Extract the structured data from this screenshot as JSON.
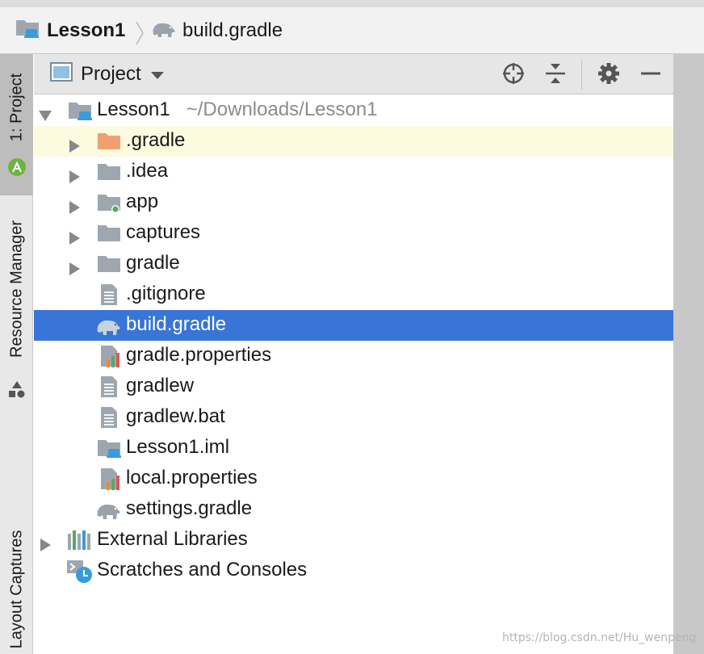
{
  "breadcrumb": {
    "project": "Lesson1",
    "file": "build.gradle"
  },
  "tool_strip": {
    "tabs": [
      {
        "label": "1: Project",
        "icon": "android-icon",
        "active": true
      },
      {
        "label": "Resource Manager",
        "icon": "shapes-icon",
        "active": false
      },
      {
        "label": "Layout Captures",
        "active": false
      }
    ]
  },
  "panel": {
    "view_selector": "Project",
    "actions": [
      "locate-icon",
      "collapse-all-icon",
      "gear-icon",
      "minimize-icon"
    ]
  },
  "tree": {
    "root": {
      "label": "Lesson1",
      "path": "~/Downloads/Lesson1"
    },
    "items": [
      {
        "label": ".gradle",
        "icon": "folder-orange-icon",
        "expandable": true,
        "state": "hover"
      },
      {
        "label": ".idea",
        "icon": "folder-icon",
        "expandable": true
      },
      {
        "label": "app",
        "icon": "module-folder-icon",
        "expandable": true
      },
      {
        "label": "captures",
        "icon": "folder-icon",
        "expandable": true
      },
      {
        "label": "gradle",
        "icon": "folder-icon",
        "expandable": true
      },
      {
        "label": ".gitignore",
        "icon": "text-file-icon",
        "expandable": false
      },
      {
        "label": "build.gradle",
        "icon": "gradle-elephant-icon",
        "expandable": false,
        "state": "selected"
      },
      {
        "label": "gradle.properties",
        "icon": "properties-file-icon",
        "expandable": false
      },
      {
        "label": "gradlew",
        "icon": "text-file-icon",
        "expandable": false
      },
      {
        "label": "gradlew.bat",
        "icon": "text-file-icon",
        "expandable": false
      },
      {
        "label": "Lesson1.iml",
        "icon": "module-file-icon",
        "expandable": false
      },
      {
        "label": "local.properties",
        "icon": "properties-file-icon",
        "expandable": false
      },
      {
        "label": "settings.gradle",
        "icon": "gradle-elephant-icon",
        "expandable": false
      }
    ],
    "external_libraries": "External Libraries",
    "scratches": "Scratches and Consoles"
  },
  "colors": {
    "selection": "#3875d7",
    "hover_row": "#fcfbdf",
    "accent_blue": "#3a9bdc"
  },
  "watermark": "https://blog.csdn.net/Hu_wenpeng"
}
